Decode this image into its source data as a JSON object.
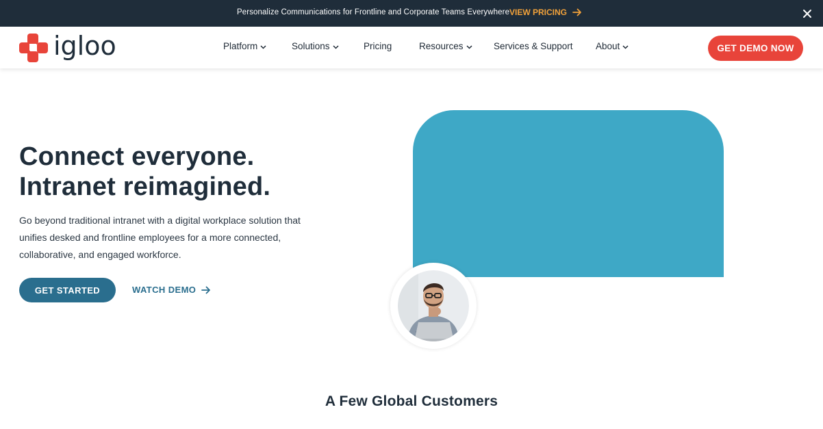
{
  "announcement": {
    "text": "Personalize Communications for Frontline and Corporate Teams Everywhere",
    "link_label": "VIEW PRICING",
    "link_color": "#f2a23a",
    "background": "#1f2d3a"
  },
  "nav": {
    "logo_text": "igloo",
    "logo_color": "#e8443a",
    "items": [
      {
        "label": "Platform",
        "has_dropdown": true
      },
      {
        "label": "Solutions",
        "has_dropdown": true
      },
      {
        "label": "Pricing",
        "has_dropdown": false
      },
      {
        "label": "Resources",
        "has_dropdown": true
      },
      {
        "label": "Services & Support",
        "has_dropdown": false
      },
      {
        "label": "About",
        "has_dropdown": true
      }
    ],
    "cta_label": "GET DEMO NOW",
    "cta_color": "#e8443a"
  },
  "hero": {
    "title": "Connect everyone. Intranet reimagined.",
    "description": "Go beyond traditional intranet with a digital workplace solution that unifies desked and frontline employees for a more connected, collaborative, and engaged workforce.",
    "primary_button": "GET STARTED",
    "secondary_link": "WATCH DEMO",
    "accent_color": "#2a6e8e",
    "panel_color": "#3ea8c6"
  },
  "customers": {
    "title": "A Few Global Customers"
  }
}
